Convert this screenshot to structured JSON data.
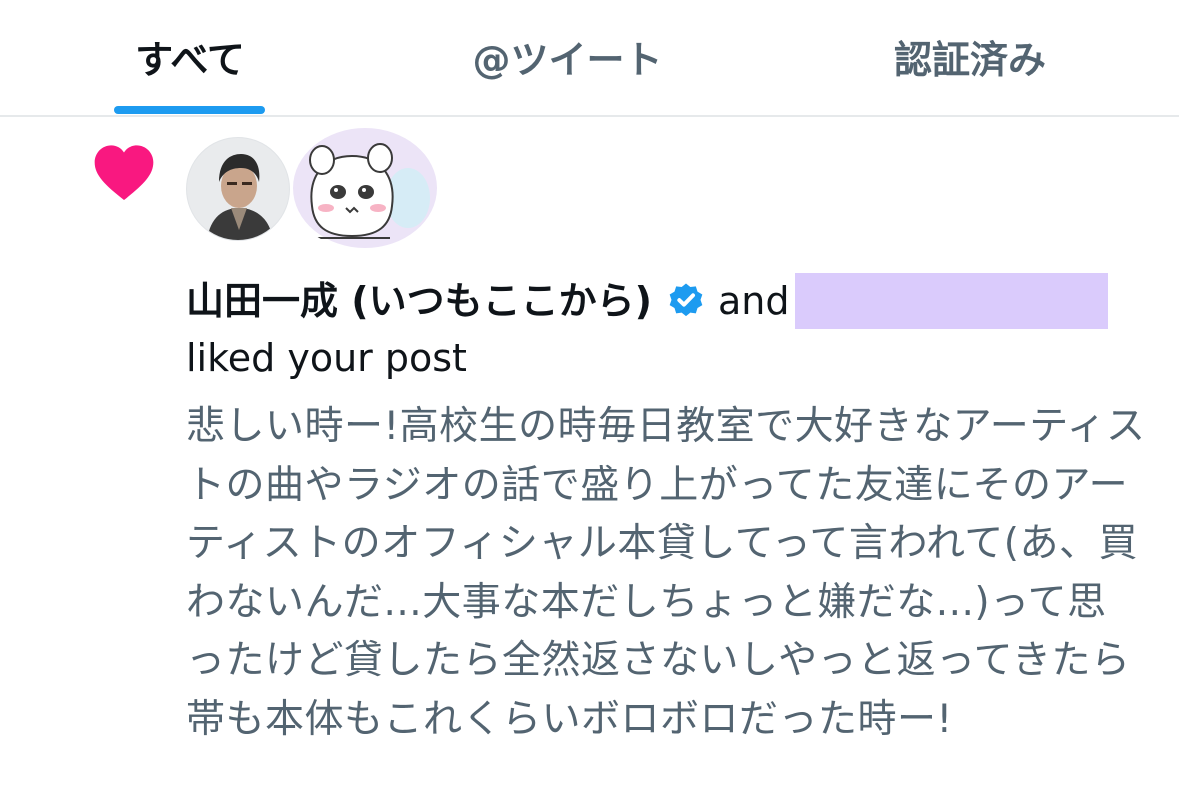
{
  "tabs": [
    {
      "label": "すべて",
      "active": true
    },
    {
      "label": "@ツイート",
      "active": false
    },
    {
      "label": "認証済み",
      "active": false
    }
  ],
  "notification": {
    "icon": "heart-icon",
    "icon_color": "#f91880",
    "user_name": "山田一成 (いつもここから)",
    "verified": true,
    "verified_color": "#1d9bf0",
    "connector": "and",
    "action_text": "liked your post",
    "post_text": "悲しい時ー!高校生の時毎日教室で大好きなアーティストの曲やラジオの話で盛り上がってた友達にそのアーティストのオフィシャル本貸してって言われて(あ、買わないんだ...大事な本だしちょっと嫌だな...)って思ったけど貸したら全然返さないしやっと返ってきたら帯も本体もこれくらいボロボロだった時ー!"
  },
  "colors": {
    "accent": "#1d9bf0",
    "muted_text": "#536471",
    "primary_text": "#0f1419",
    "redaction": "#dacbfc"
  }
}
